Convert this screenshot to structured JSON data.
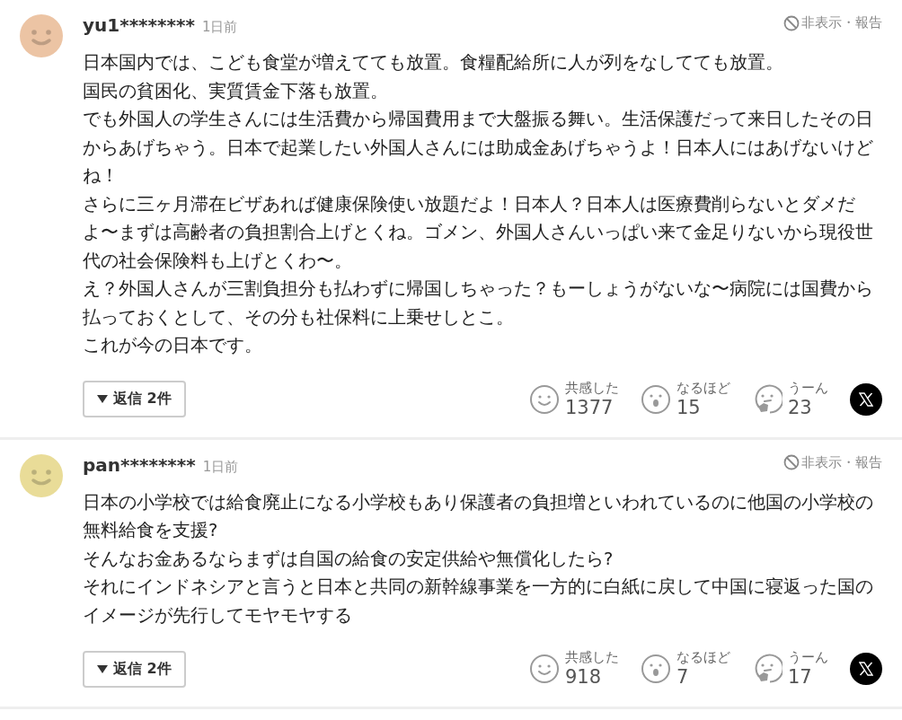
{
  "comments": [
    {
      "color": "#ecc4a4",
      "user": "yu1********",
      "time": "1日前",
      "hide_report": "非表示・報告",
      "paragraphs": [
        "日本国内では、こども食堂が増えてても放置。食糧配給所に人が列をなしてても放置。",
        "国民の貧困化、実質賃金下落も放置。",
        "でも外国人の学生さんには生活費から帰国費用まで大盤振る舞い。生活保護だって来日したその日からあげちゃう。日本で起業したい外国人さんには助成金あげちゃうよ！日本人にはあげないけどね！",
        "さらに三ヶ月滞在ビザあれば健康保険使い放題だよ！日本人？日本人は医療費削らないとダメだよ〜まずは高齢者の負担割合上げとくね。ゴメン、外国人さんいっぱい来て金足りないから現役世代の社会保険料も上げとくわ〜。",
        "え？外国人さんが三割負担分も払わずに帰国しちゃった？もーしょうがないな〜病院には国費から払っておくとして、その分も社保料に上乗せしとこ。",
        "これが今の日本です。"
      ],
      "replies": "返信 2件",
      "reactions": [
        {
          "kind": "smile",
          "label": "共感した",
          "count": "1377"
        },
        {
          "kind": "wow",
          "label": "なるほど",
          "count": "15"
        },
        {
          "kind": "think",
          "label": "うーん",
          "count": "23"
        }
      ]
    },
    {
      "color": "#e9dc98",
      "user": "pan********",
      "time": "1日前",
      "hide_report": "非表示・報告",
      "paragraphs": [
        "日本の小学校では給食廃止になる小学校もあり保護者の負担増といわれているのに他国の小学校の無料給食を支援?",
        "そんなお金あるならまずは自国の給食の安定供給や無償化したら?",
        "それにインドネシアと言うと日本と共同の新幹線事業を一方的に白紙に戻して中国に寝返った国のイメージが先行してモヤモヤする"
      ],
      "replies": "返信 2件",
      "reactions": [
        {
          "kind": "smile",
          "label": "共感した",
          "count": "918"
        },
        {
          "kind": "wow",
          "label": "なるほど",
          "count": "7"
        },
        {
          "kind": "think",
          "label": "うーん",
          "count": "17"
        }
      ]
    }
  ]
}
